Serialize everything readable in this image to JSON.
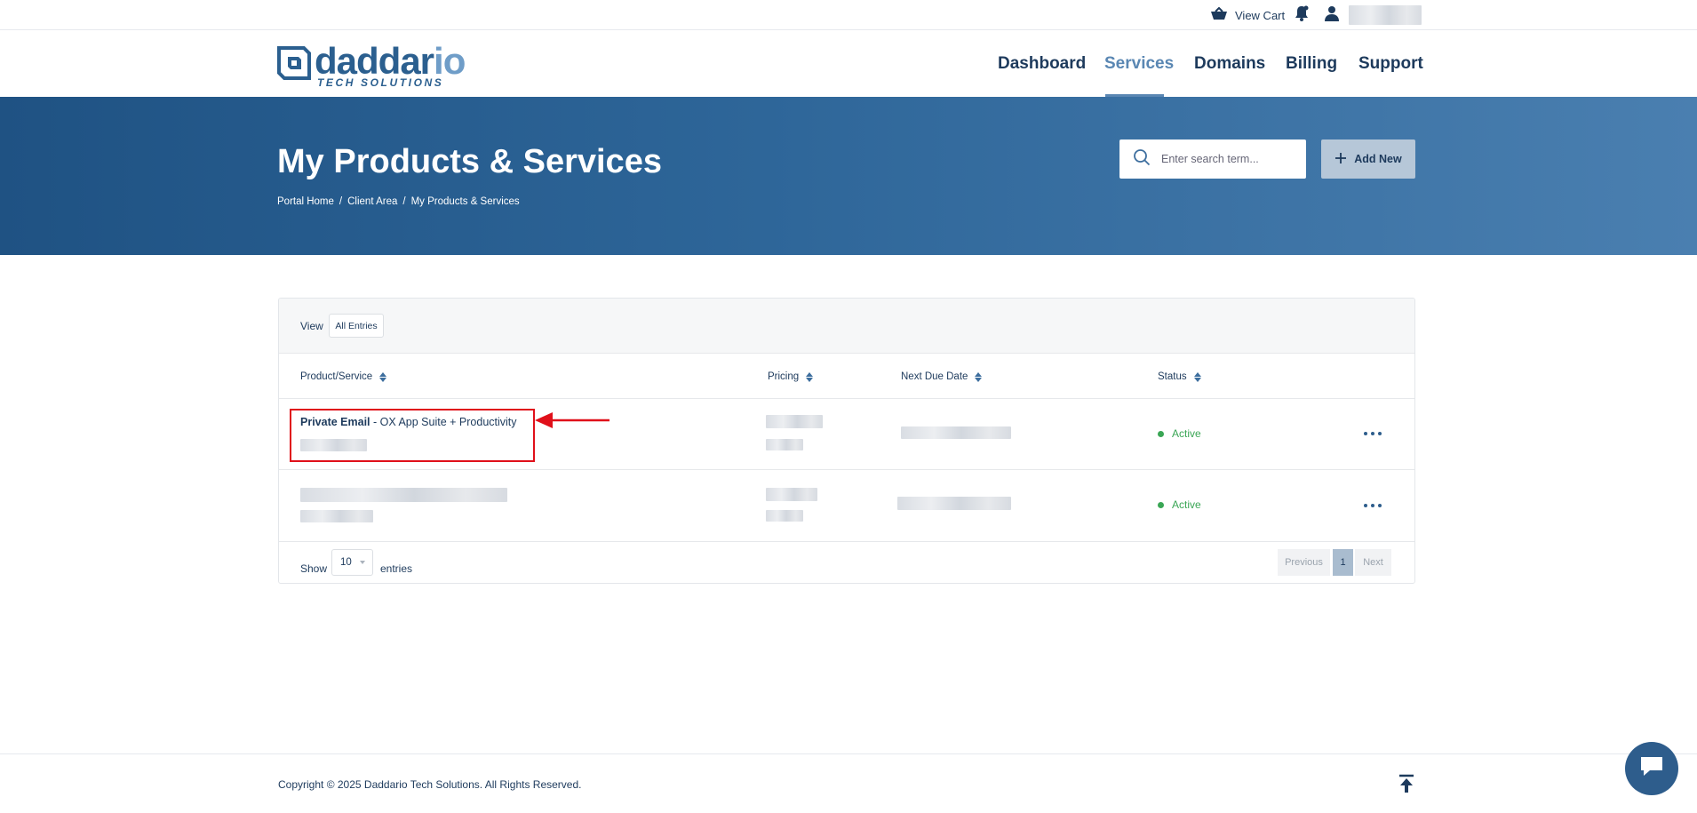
{
  "topbar": {
    "cart_label": "View Cart",
    "icons": [
      "cart-icon",
      "bell-icon",
      "user-icon"
    ]
  },
  "header": {
    "brand_name": "daddar",
    "brand_name_suffix": "io",
    "brand_subtitle": "TECH SOLUTIONS",
    "nav": [
      {
        "label": "Dashboard",
        "active": false
      },
      {
        "label": "Services",
        "active": true
      },
      {
        "label": "Domains",
        "active": false
      },
      {
        "label": "Billing",
        "active": false
      },
      {
        "label": "Support",
        "active": false
      }
    ]
  },
  "hero": {
    "title": "My Products & Services",
    "breadcrumb": [
      "Portal Home",
      "Client Area",
      "My Products & Services"
    ],
    "breadcrumb_separator": "/",
    "search_placeholder": "Enter search term...",
    "add_new_label": "Add New"
  },
  "table": {
    "view_label": "View",
    "view_filter": "All Entries",
    "columns": [
      "Product/Service",
      "Pricing",
      "Next Due Date",
      "Status"
    ],
    "rows": [
      {
        "product_name": "Private Email",
        "product_detail": " - OX App Suite + Productivity",
        "status": "Active"
      },
      {
        "product_name": "",
        "product_detail": "",
        "status": "Active"
      }
    ],
    "show_label": "Show",
    "page_length": "10",
    "entries_label": "entries",
    "pagination": {
      "previous": "Previous",
      "current_page": "1",
      "next": "Next"
    }
  },
  "footer": {
    "copyright": "Copyright © 2025 Daddario Tech Solutions. All Rights Reserved."
  },
  "colors": {
    "brand": "#2b5f8f",
    "hero_start": "#1f5283",
    "hero_end": "#4a7fb0",
    "status_active": "#3aa655",
    "annotation": "#e0101a"
  }
}
